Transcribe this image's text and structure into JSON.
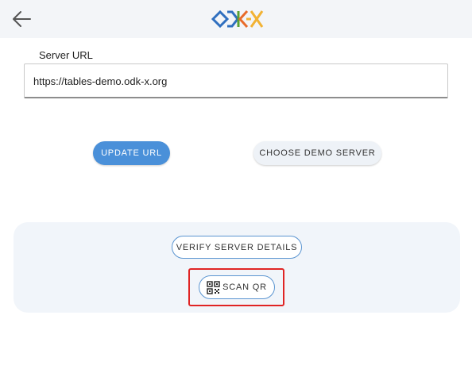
{
  "header": {
    "back_icon": "arrow-left-icon",
    "logo_text": "ODK-X",
    "logo_colors": [
      "#2f6fbf",
      "#e86b2a",
      "#f2b233",
      "#5aa133"
    ]
  },
  "form": {
    "server_url_label": "Server URL",
    "server_url_value": "https://tables-demo.odk-x.org"
  },
  "actions": {
    "update_url_label": "UPDATE URL",
    "choose_demo_label": "CHOOSE DEMO SERVER"
  },
  "panel": {
    "verify_label": "VERIFY SERVER DETAILS",
    "scan_qr_label": "SCAN QR",
    "scan_icon": "qr-code-icon"
  },
  "colors": {
    "primary": "#4a90d9",
    "highlight": "#e02424",
    "panel_bg": "#f1f5fa"
  }
}
